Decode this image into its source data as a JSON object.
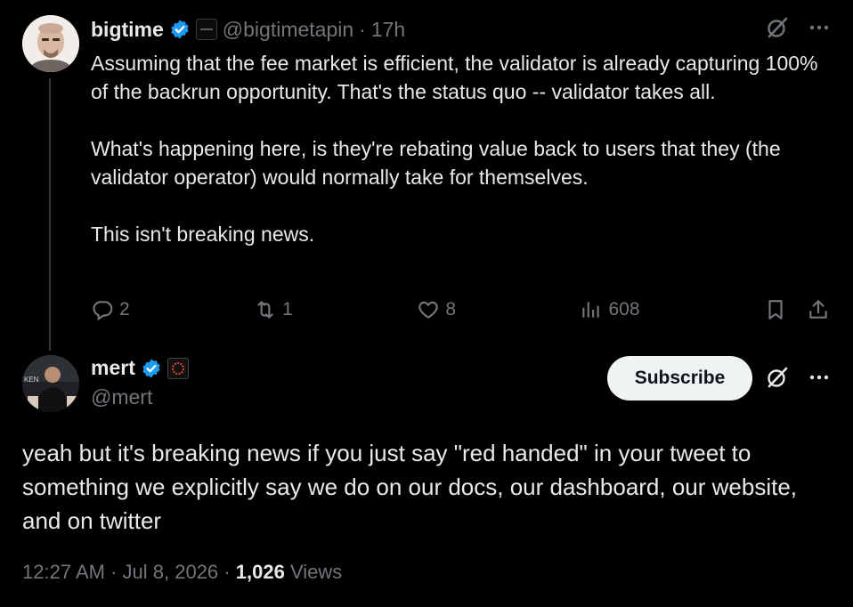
{
  "colors": {
    "background": "#000000",
    "text": "#e7e9ea",
    "muted": "#71767b",
    "verified": "#1d9bf0",
    "subscribe_bg": "#eff3f4"
  },
  "parent_tweet": {
    "author_name": "bigtime",
    "handle": "@bigtimetapin",
    "separator": "·",
    "time": "17h",
    "avatar_icon": "avatar-photo",
    "affiliation_icon": "affiliation-badge",
    "paragraphs": [
      "Assuming that the fee market is efficient, the validator is already capturing 100% of the backrun opportunity. That's the status quo -- validator takes all.",
      "What's happening here, is they're rebating value back to users that they (the validator operator) would normally take for themselves.",
      "This isn't breaking news."
    ],
    "stats": {
      "replies": "2",
      "reposts": "1",
      "likes": "8",
      "views": "608"
    }
  },
  "main_tweet": {
    "author_name": "mert",
    "handle": "@mert",
    "avatar_icon": "avatar-photo",
    "affiliation_icon": "org-badge",
    "subscribe_label": "Subscribe",
    "text": "yeah but it's breaking news if you just say \"red handed\" in your tweet to something we explicitly say we do on our docs, our dashboard, our website, and on twitter",
    "time": "12:27 AM",
    "date": "Jul 8, 2026",
    "views_count": "1,026",
    "views_label": "Views"
  }
}
